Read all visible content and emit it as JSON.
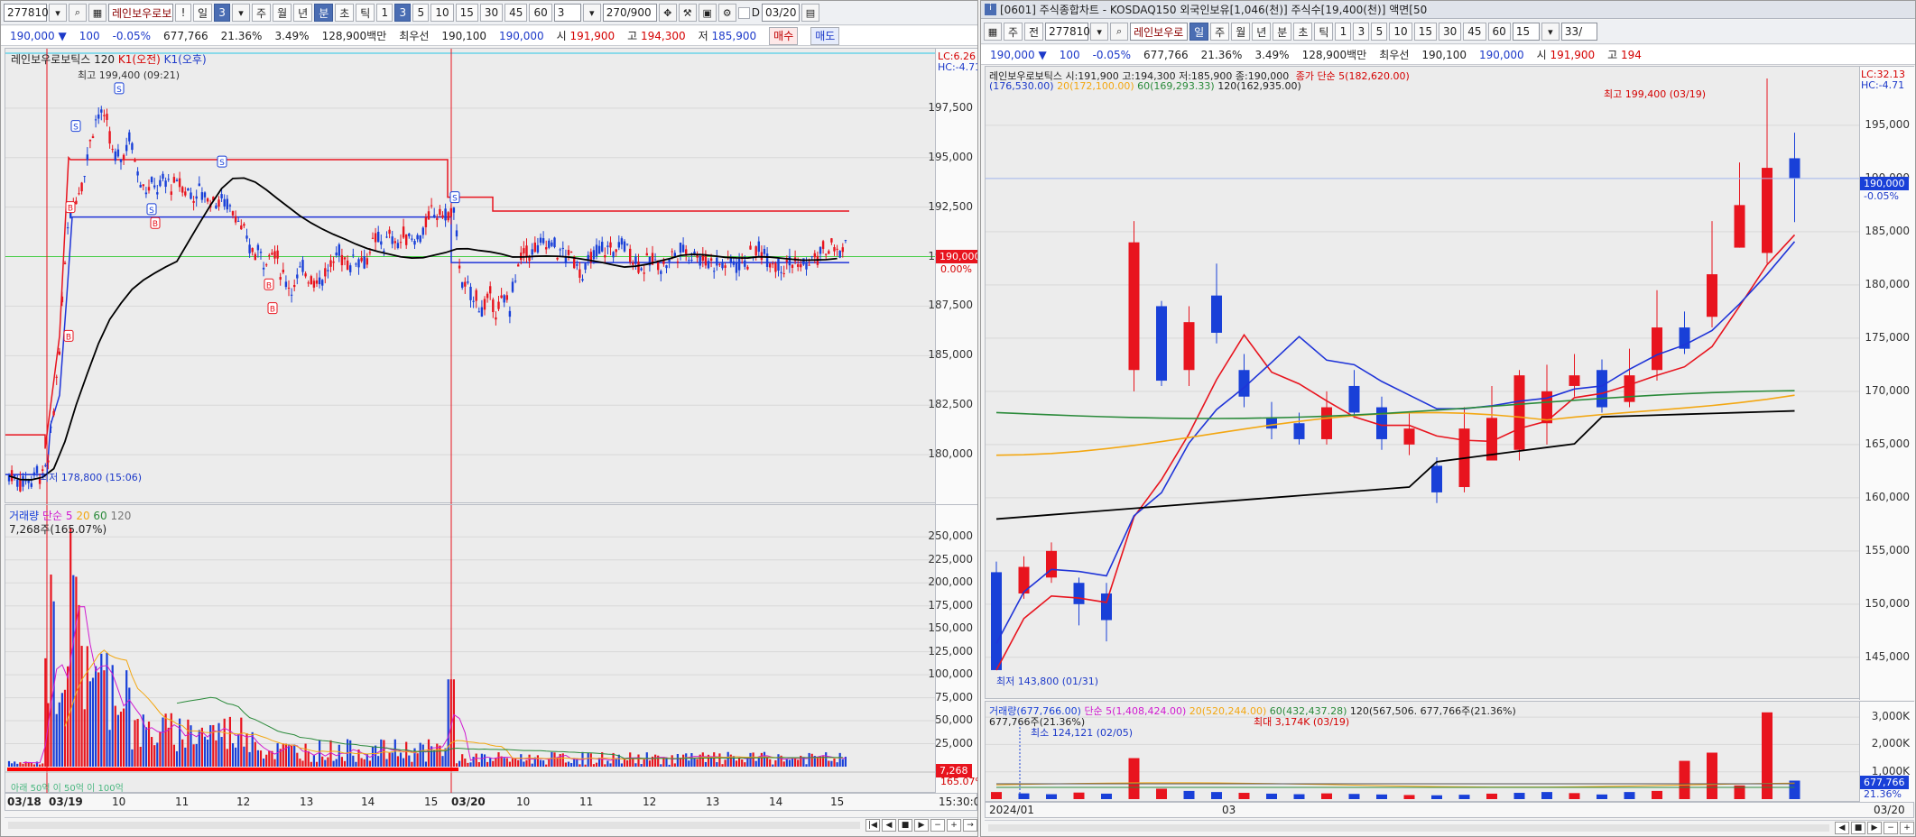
{
  "left": {
    "toolbar": {
      "code": "277810",
      "name": "레인보우로보",
      "period_day": "일",
      "period_num": "3",
      "tabs": [
        "주",
        "월",
        "년",
        "분",
        "초",
        "틱"
      ],
      "selected_tab": "분",
      "intervals": [
        "1",
        "3",
        "5",
        "10",
        "15",
        "30",
        "45",
        "60"
      ],
      "selected_interval": "3",
      "interval_input": "3",
      "count": "270/900",
      "checkbox_label": "D",
      "date": "03/20"
    },
    "quote": {
      "price": "190,000",
      "arrow": "▼",
      "change": "100",
      "pct": "-0.05%",
      "volume": "677,766",
      "ratio1": "21.36%",
      "ratio2": "3.49%",
      "amount": "128,900백만",
      "pri_label": "최우선",
      "bid": "190,100",
      "ask": "190,000",
      "open_label": "시",
      "open": "191,900",
      "high_label": "고",
      "high": "194,300",
      "low_label": "저",
      "low": "185,900",
      "buy": "매수",
      "sell": "매도"
    },
    "chart": {
      "legend_name": "레인보우로보틱스",
      "legend_period": "120",
      "legend_k1": "K1(오전)",
      "legend_k2": "K1(오후)",
      "lc": "LC:6.26",
      "hc": "HC:-4.71",
      "max_note": "최고 199,400 (09:21)",
      "min_note": "최저 178,800 (15:06)",
      "price_ticks": [
        "197,500",
        "195,000",
        "192,500",
        "190,000",
        "187,500",
        "185,000",
        "182,500",
        "180,000"
      ],
      "current": "190,000",
      "current_pct": "0.00%"
    },
    "volume": {
      "legend_main": "거래량",
      "legend_ma": "단순 5",
      "legend_20": "20",
      "legend_60": "60",
      "legend_120": "120",
      "max_vol": "7,268주(165.07%)",
      "vol_ticks": [
        "250,000",
        "225,000",
        "200,000",
        "175,000",
        "150,000",
        "125,000",
        "100,000",
        "75,000",
        "50,000",
        "25,000"
      ],
      "current_vol": "7,268",
      "current_vol_pct": "165.07%",
      "bottom_note": "아래 50억 이 50억 이 100억"
    },
    "xaxis": [
      "03/18",
      "03/19",
      "10",
      "11",
      "12",
      "13",
      "14",
      "15",
      "03/20",
      "10",
      "11",
      "12",
      "13",
      "14",
      "15"
    ],
    "time_label": "15:30:00"
  },
  "right": {
    "title": "[0601] 주식종합차트 - KOSDAQ150 외국인보유[1,046(천)] 주식수[19,400(천)] 액면[50",
    "toolbar": {
      "code": "277810",
      "name": "레인보우로",
      "period_day": "일",
      "tabs": [
        "주",
        "월",
        "년",
        "분",
        "초",
        "틱"
      ],
      "intervals": [
        "1",
        "3",
        "5",
        "10",
        "15",
        "30",
        "45",
        "60"
      ],
      "extra": "15",
      "count": "33/"
    },
    "quote": {
      "price": "190,000",
      "arrow": "▼",
      "change": "100",
      "pct": "-0.05%",
      "volume": "677,766",
      "ratio1": "21.36%",
      "ratio2": "3.49%",
      "amount": "128,900백만",
      "pri_label": "최우선",
      "bid": "190,100",
      "ask": "190,000",
      "open_label": "시",
      "open": "191,900",
      "high_label": "고",
      "high": "194"
    },
    "chart": {
      "legend_line1": "레인보우로보틱스 시:191,900 고:194,300 저:185,900 종:190,000",
      "legend_ma": "종가 단순 5(182,620.00)",
      "legend_line2a": "(176,530.00)",
      "legend_line2b": "20(172,100.00)",
      "legend_line2c": "60(169,293.33)",
      "legend_line2d": "120(162,935.00)",
      "lc": "LC:32.13",
      "hc": "HC:-4.71",
      "max_note": "최고 199,400 (03/19)",
      "min_note": "최저 143,800 (01/31)",
      "price_ticks": [
        "195,000",
        "190,000",
        "185,000",
        "180,000",
        "175,000",
        "170,000",
        "165,000",
        "160,000",
        "155,000",
        "150,000",
        "145,000"
      ],
      "current": "190,000",
      "current_pct": "-0.05%"
    },
    "volume": {
      "legend_main": "거래량(677,766.00)",
      "legend_ma": "단순 5(1,408,424.00)",
      "legend_20": "20(520,244.00)",
      "legend_60": "60(432,437.28)",
      "legend_120": "120(567,506.",
      "legend_end": "677,766주(21.36%)",
      "sub": "677,766주(21.36%)",
      "min_note": "최소 124,121 (02/05)",
      "max_note": "최대 3,174K (03/19)",
      "vol_ticks": [
        "3,000K",
        "2,000K",
        "1,000K"
      ],
      "current_vol": "677,766",
      "current_vol_pct": "21.36%"
    },
    "xaxis": [
      "2024/01",
      "03",
      "03/20"
    ]
  },
  "colors": {
    "up": "#e8141e",
    "down": "#1940d8",
    "ma5": "#e8141e",
    "ma20": "#f3a712",
    "ma60": "#2a8a3a",
    "ma120": "#000000",
    "ma_blue": "#1f34d8"
  }
}
